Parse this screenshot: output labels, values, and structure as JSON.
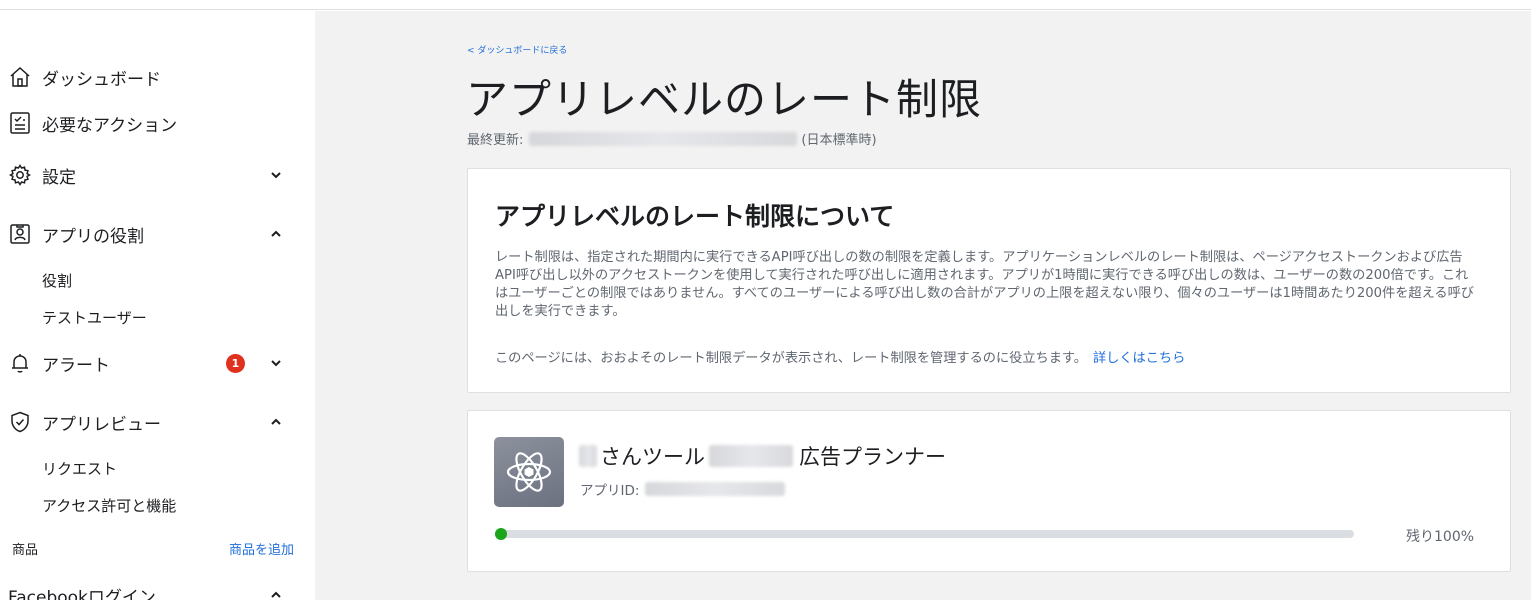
{
  "sidebar": {
    "dashboard": "ダッシュボード",
    "required_actions": "必要なアクション",
    "settings": "設定",
    "app_roles": "アプリの役割",
    "roles": "役割",
    "test_users": "テストユーザー",
    "alerts": "アラート",
    "alerts_badge": "1",
    "app_review": "アプリレビュー",
    "requests": "リクエスト",
    "permissions": "アクセス許可と機能",
    "products_label": "商品",
    "add_product": "商品を追加",
    "facebook_login": "Facebookログイン",
    "icons": {
      "dashboard": "home-icon",
      "required_actions": "checklist-icon",
      "settings": "gear-icon",
      "app_roles": "id-badge-icon",
      "alerts": "bell-icon",
      "app_review": "shield-check-icon"
    }
  },
  "main": {
    "back_link": "< ダッシュボードに戻る",
    "title": "アプリレベルのレート制限",
    "updated_label": "最終更新:",
    "updated_tz": "(日本標準時)",
    "about": {
      "title": "アプリレベルのレート制限について",
      "body": "レート制限は、指定された期間内に実行できるAPI呼び出しの数の制限を定義します。アプリケーションレベルのレート制限は、ページアクセストークンおよび広告API呼び出し以外のアクセストークンを使用して実行された呼び出しに適用されます。アプリが1時間に実行できる呼び出しの数は、ユーザーの数の200倍です。これはユーザーごとの制限ではありません。すべてのユーザーによる呼び出し数の合計がアプリの上限を超えない限り、個々のユーザーは1時間あたり200件を超える呼び出しを実行できます。",
      "footer": "このページには、おおよそのレート制限データが表示され、レート制限を管理するのに役立ちます。",
      "learn_more": "詳しくはこちら"
    },
    "app": {
      "name_part1": "さんツール",
      "name_part2": "広告プランナー",
      "id_label": "アプリID:",
      "icon": "atom-icon",
      "usage_fraction": 0.01,
      "remaining": "残り100%",
      "accent_color": "#1aa51a"
    }
  },
  "colors": {
    "link": "#216fdb",
    "badge": "#e0301e",
    "background": "#f2f2f2"
  }
}
